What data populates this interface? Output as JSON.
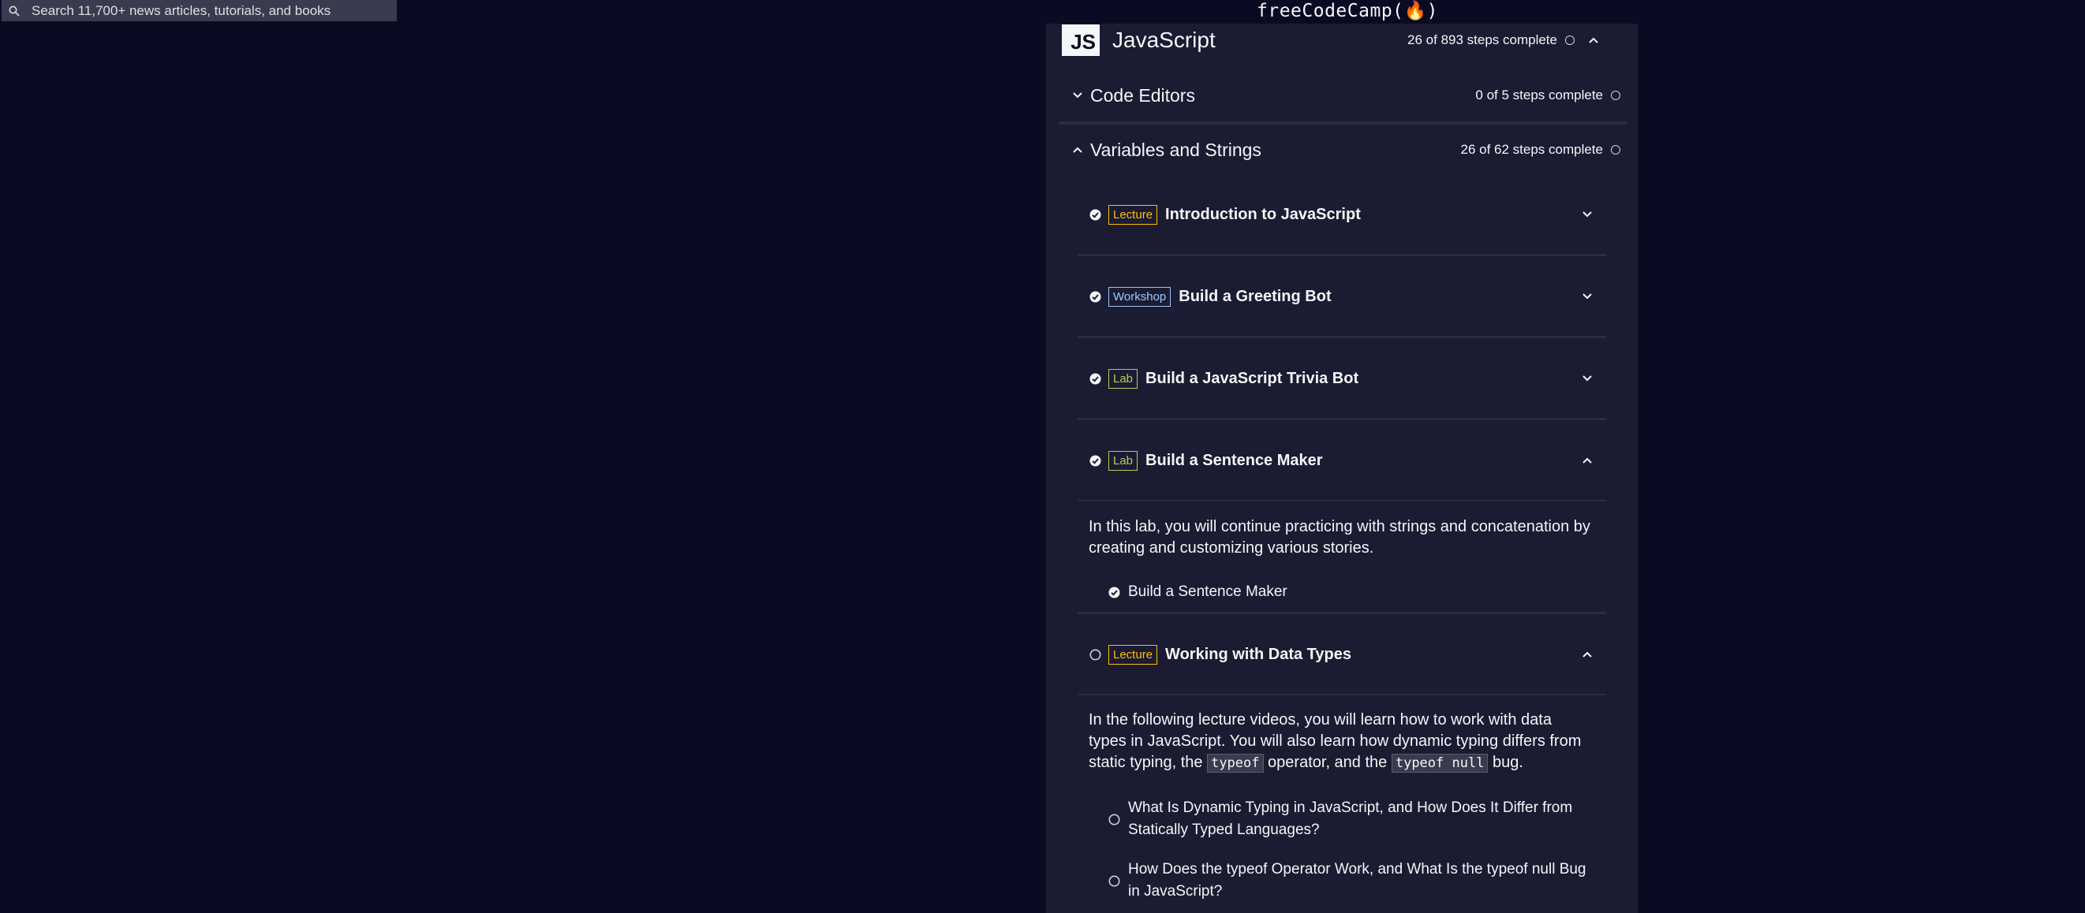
{
  "search": {
    "placeholder": "Search 11,700+ news articles, tutorials, and books"
  },
  "logo": {
    "text": "freeCodeCamp(🔥)"
  },
  "certification": {
    "badge": "JS",
    "title": "JavaScript",
    "progress": "26 of 893 steps complete"
  },
  "modules": [
    {
      "title": "Code Editors",
      "progress": "0 of 5 steps complete",
      "expanded": false
    },
    {
      "title": "Variables and Strings",
      "progress": "26 of 62 steps complete",
      "expanded": true
    }
  ],
  "blocks": [
    {
      "tag": "Lecture",
      "title": "Introduction to JavaScript",
      "completed": true,
      "expanded": false
    },
    {
      "tag": "Workshop",
      "title": "Build a Greeting Bot",
      "completed": true,
      "expanded": false
    },
    {
      "tag": "Lab",
      "title": "Build a JavaScript Trivia Bot",
      "completed": true,
      "expanded": false
    },
    {
      "tag": "Lab",
      "title": "Build a Sentence Maker",
      "completed": true,
      "expanded": true,
      "description": "In this lab, you will continue practicing with strings and concatenation by creating and customizing various stories.",
      "steps": [
        {
          "label": "Build a Sentence Maker",
          "completed": true
        }
      ]
    },
    {
      "tag": "Lecture",
      "title": "Working with Data Types",
      "completed": false,
      "expanded": true,
      "description_parts": {
        "a": "In the following lecture videos, you will learn how to work with data types in JavaScript. You will also learn how dynamic typing differs from static typing, the ",
        "code1": "typeof",
        "b": " operator, and the ",
        "code2": "typeof null",
        "c": " bug."
      },
      "steps": [
        {
          "label": "What Is Dynamic Typing in JavaScript, and How Does It Differ from Statically Typed Languages?",
          "completed": false
        },
        {
          "label": "How Does the typeof Operator Work, and What Is the typeof null Bug in JavaScript?",
          "completed": false
        }
      ]
    }
  ],
  "colors": {
    "background": "#0a0a23",
    "panel": "#1b1b32",
    "lecture_tag": "#ffbf00",
    "workshop_tag": "#99c9ff",
    "lab_tag": "#acd157"
  }
}
